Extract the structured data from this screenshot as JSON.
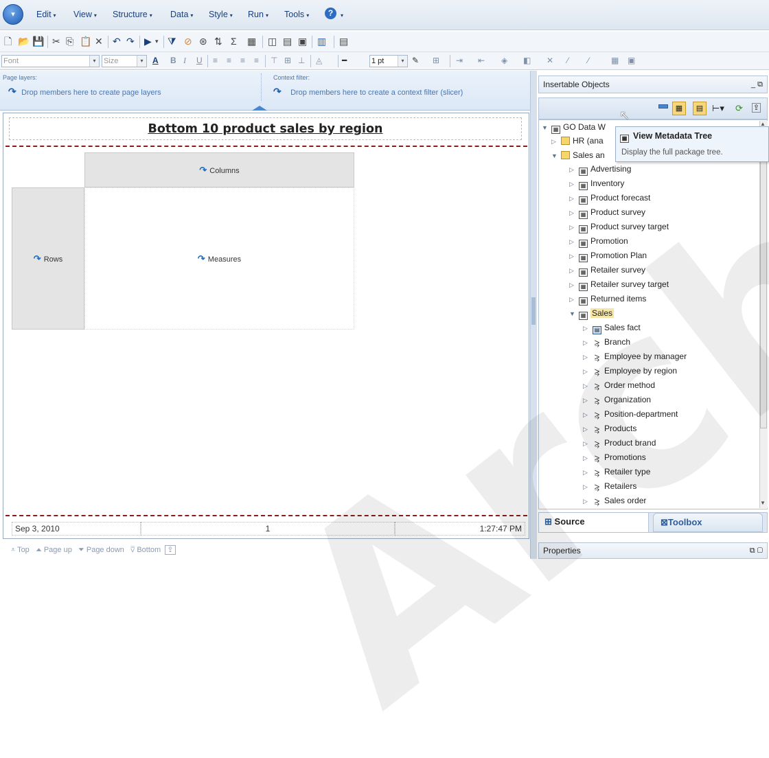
{
  "menu": {
    "app_button_icon": "dropdown-arrow-icon",
    "items": [
      "Edit",
      "View",
      "Structure",
      "Data",
      "Style",
      "Run",
      "Tools"
    ],
    "help_icon": "?"
  },
  "format_toolbar": {
    "font_placeholder": "Font",
    "size_placeholder": "Size",
    "line_weight": "1 pt"
  },
  "drop_zones": {
    "page_layers_label": "Page layers:",
    "page_layers_hint": "Drop members here to create page layers",
    "context_label": "Context filter:",
    "context_hint": "Drop members here to create a context filter (slicer)"
  },
  "report": {
    "title": "Bottom 10 product sales by region",
    "columns_label": "Columns",
    "rows_label": "Rows",
    "measures_label": "Measures",
    "footer_date": "Sep 3, 2010",
    "footer_page": "1",
    "footer_time": "1:27:47 PM"
  },
  "pager": {
    "top": "Top",
    "page_up": "Page up",
    "page_down": "Page down",
    "bottom": "Bottom"
  },
  "insertable_objects": {
    "title": "Insertable Objects",
    "tooltip_title": "View Metadata Tree",
    "tooltip_desc": "Display the full package tree.",
    "tree": {
      "root": "GO Data W",
      "hr": "HR (ana",
      "sales_and": "Sales an",
      "namespaces": [
        "Advertising",
        "Inventory",
        "Product forecast",
        "Product survey",
        "Product survey target",
        "Promotion",
        "Promotion Plan",
        "Retailer survey",
        "Retailer survey target",
        "Returned items"
      ],
      "sales": "Sales",
      "sales_children": [
        "Sales fact",
        "Branch",
        "Employee by manager",
        "Employee by region",
        "Order method",
        "Organization",
        "Position-department",
        "Products",
        "Product brand",
        "Promotions",
        "Retailer type",
        "Retailers",
        "Sales order"
      ]
    },
    "tabs": {
      "source": "Source",
      "toolbox": "Toolbox"
    }
  },
  "properties": {
    "title": "Properties"
  },
  "watermark": "Archived",
  "colors": {
    "accent": "#1f5fb0",
    "report_border": "#8b1a1a"
  }
}
